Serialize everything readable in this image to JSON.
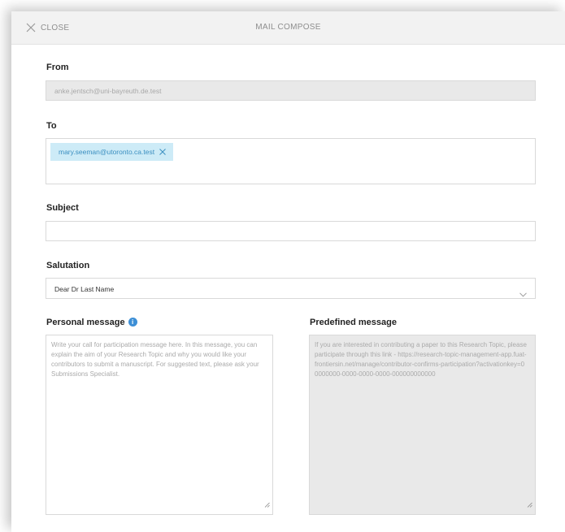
{
  "header": {
    "close_label": "CLOSE",
    "title": "MAIL COMPOSE"
  },
  "from": {
    "label": "From",
    "value": "anke.jentsch@uni-bayreuth.de.test"
  },
  "to": {
    "label": "To",
    "recipients": [
      "mary.seeman@utoronto.ca.test"
    ]
  },
  "subject": {
    "label": "Subject",
    "value": ""
  },
  "salutation": {
    "label": "Salutation",
    "selected": "Dear Dr Last Name"
  },
  "personal_message": {
    "label": "Personal message",
    "placeholder": "Write your call for participation message here. In this message, you can explain the aim of your Research Topic and why you would like your contributors to submit a manuscript. For suggested text, please ask your Submissions Specialist."
  },
  "predefined_message": {
    "label": "Predefined message",
    "text": "If you are interested in contributing a paper to this Research Topic, please participate through this link - https://research-topic-management-app.fuat-frontiersin.net/manage/contributor-confirms-participation?activationkey=00000000-0000-0000-0000-000000000000"
  },
  "icons": [
    "close-icon",
    "remove-recipient-icon",
    "chevron-down-icon",
    "info-icon",
    "resize-grip-icon"
  ],
  "colors": {
    "header_bg": "#f2f2f2",
    "chip_bg": "#cdebf7",
    "chip_text": "#3b8fc0",
    "info_icon": "#3d8fd6",
    "disabled_bg": "#e9e9e9"
  }
}
